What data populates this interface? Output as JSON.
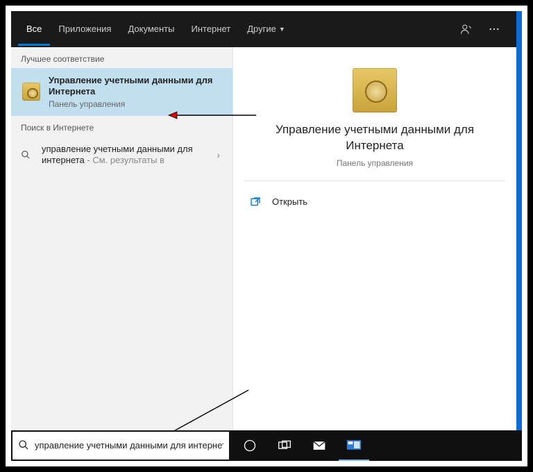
{
  "header": {
    "tabs": [
      "Все",
      "Приложения",
      "Документы",
      "Интернет",
      "Другие"
    ],
    "active_tab": 0
  },
  "left": {
    "best_match_label": "Лучшее соответствие",
    "best_match": {
      "title": "Управление учетными данными для Интернета",
      "subtitle": "Панель управления"
    },
    "web_section_label": "Поиск в Интернете",
    "web_item": {
      "query": "управление учетными данными для интернета",
      "suffix": " - См. результаты в"
    }
  },
  "right": {
    "title": "Управление учетными данными для Интернета",
    "subtitle": "Панель управления",
    "actions": {
      "open": "Открыть"
    }
  },
  "taskbar": {
    "search_value": "управление учетными данными для интернета"
  }
}
